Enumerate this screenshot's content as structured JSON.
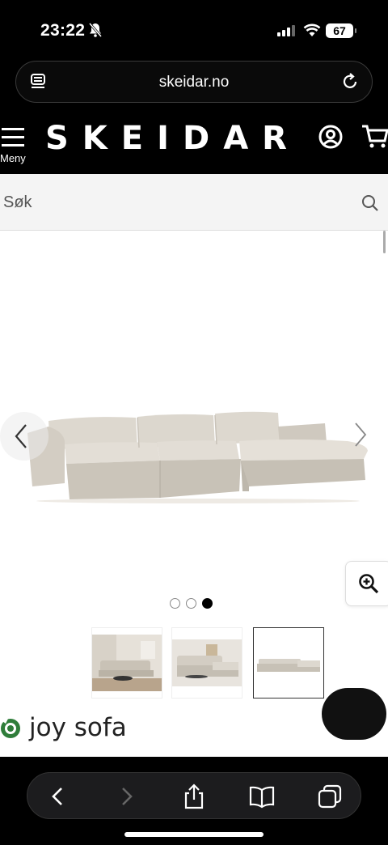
{
  "status_bar": {
    "time": "23:22",
    "battery": "67"
  },
  "browser": {
    "url": "skeidar.no"
  },
  "header": {
    "menu_label": "Meny",
    "logo": "SKEIDAR"
  },
  "search": {
    "placeholder": "Søk"
  },
  "gallery": {
    "active_index": 3,
    "image_count": 3
  },
  "product": {
    "title_partial": "joy sofa"
  },
  "colors": {
    "header_bg": "#000000",
    "search_bg": "#f4f4f4",
    "sofa_fabric": "#d6d0c6"
  },
  "icons": [
    "bell-slash-icon",
    "signal-icon",
    "wifi-icon",
    "battery-icon",
    "page-icon",
    "reload-icon",
    "hamburger-icon",
    "user-icon",
    "cart-icon",
    "search-icon",
    "chevron-left-icon",
    "chevron-right-icon",
    "zoom-in-icon",
    "eco-badge-icon",
    "chat-icon",
    "back-icon",
    "forward-icon",
    "share-icon",
    "bookmarks-icon",
    "tabs-icon"
  ]
}
